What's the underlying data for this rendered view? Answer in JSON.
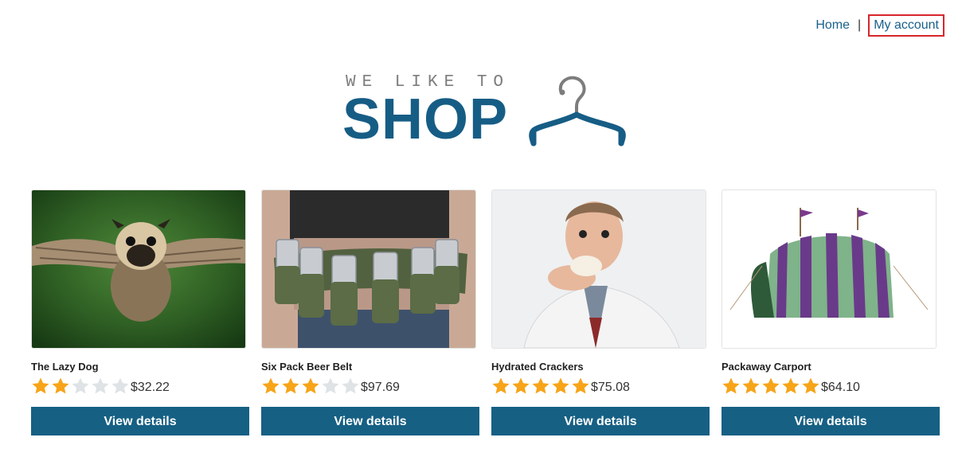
{
  "nav": {
    "home": "Home",
    "separator": "|",
    "account": "My account"
  },
  "logo": {
    "tagline": "WE LIKE TO",
    "word": "SHOP"
  },
  "colors": {
    "brand": "#165d85",
    "button": "#166084",
    "star_on": "#f7a418",
    "star_off": "#dfe3e6",
    "highlight": "#d7262b"
  },
  "products": [
    {
      "name": "The Lazy Dog",
      "rating": 2,
      "max_rating": 5,
      "price": "$32.22",
      "button": "View details",
      "image": "flying-pug-photo"
    },
    {
      "name": "Six Pack Beer Belt",
      "rating": 3,
      "max_rating": 5,
      "price": "$97.69",
      "button": "View details",
      "image": "beer-belt-photo"
    },
    {
      "name": "Hydrated Crackers",
      "rating": 5,
      "max_rating": 5,
      "price": "$75.08",
      "button": "View details",
      "image": "man-eating-cracker-photo"
    },
    {
      "name": "Packaway Carport",
      "rating": 5,
      "max_rating": 5,
      "price": "$64.10",
      "button": "View details",
      "image": "striped-tent-photo"
    }
  ]
}
